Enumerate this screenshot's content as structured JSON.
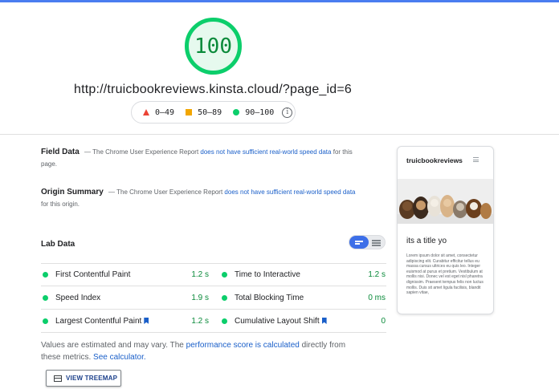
{
  "report": {
    "score": "100",
    "url": "http://truicbookreviews.kinsta.cloud/?page_id=6",
    "colors": {
      "pass": "#0cce6b",
      "average": "#ffa400",
      "fail": "#ff4e42",
      "link": "#1a5fc9",
      "accent": "#4a7df0"
    }
  },
  "legend": {
    "fail_range": "0–49",
    "average_range": "50–89",
    "pass_range": "90–100",
    "info_icon": "info-icon"
  },
  "field_data": {
    "heading": "Field Data",
    "text_before": "— The Chrome User Experience Report",
    "link_text": "does not have sufficient real-world speed data",
    "text_after": "for this page."
  },
  "origin_summary": {
    "heading": "Origin Summary",
    "text_before": "— The Chrome User Experience Report",
    "link_text": "does not have sufficient real-world speed data",
    "text_after": "for this origin."
  },
  "lab_data": {
    "heading": "Lab Data",
    "metrics": [
      {
        "label": "First Contentful Paint",
        "value": "1.2 s"
      },
      {
        "label": "Time to Interactive",
        "value": "1.2 s"
      },
      {
        "label": "Speed Index",
        "value": "1.9 s"
      },
      {
        "label": "Total Blocking Time",
        "value": "0 ms"
      },
      {
        "label": "Largest Contentful Paint",
        "value": "1.2 s"
      },
      {
        "label": "Cumulative Layout Shift",
        "value": "0"
      }
    ]
  },
  "note": {
    "text_1": "Values are estimated and may vary. The",
    "link_1": "performance score is calculated",
    "text_2": "directly from these metrics.",
    "link_2": "See calculator."
  },
  "treemap_button": {
    "label": "VIEW TREEMAP"
  },
  "preview": {
    "site_title": "truicbookreviews",
    "post_heading": "its a title yo",
    "body_text": "Lorem ipsum dolor sit amet, consectetur adipiscing elit. Curabitur efficitur tellus eu massa cursus ultrices eu quis leo. Integer euismod at purus et pretium. Vestibulum at mollis nisi. Donec vel est eget nisl pharetra dignissim. Praesent tempus felis non luctus mollis. Duis sit amet ligula facilisis, blandit sapien vitae,"
  }
}
